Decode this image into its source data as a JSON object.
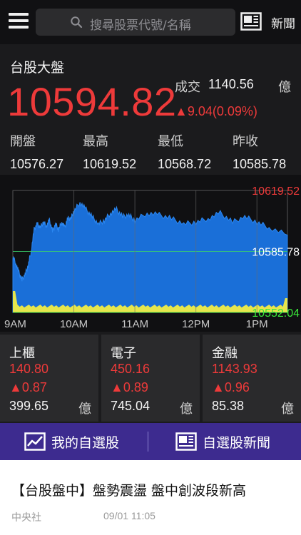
{
  "topbar": {
    "search_placeholder": "搜尋股票代號/名稱",
    "news_label": "新聞"
  },
  "index": {
    "title": "台股大盤",
    "value": "10594.82",
    "volume_label": "成交",
    "volume_value": "1140.56",
    "volume_unit": "億",
    "change": "▲9.04(0.09%)",
    "stats": [
      {
        "label": "開盤",
        "value": "10576.27"
      },
      {
        "label": "最高",
        "value": "10619.52"
      },
      {
        "label": "最低",
        "value": "10568.72"
      },
      {
        "label": "昨收",
        "value": "10585.78"
      }
    ]
  },
  "chart_data": {
    "type": "area",
    "x_ticks": [
      "9AM",
      "10AM",
      "11AM",
      "12PM",
      "1PM"
    ],
    "y_labels": [
      {
        "value": "10619.52",
        "color": "#ee3a3a"
      },
      {
        "value": "10585.78",
        "color": "#ffffff"
      },
      {
        "value": "10552.04",
        "color": "#39e639"
      }
    ],
    "ylim": [
      10552.04,
      10619.52
    ],
    "reference": 10585.78,
    "series": [
      {
        "kind": "price-area",
        "color": "#1a6fd8",
        "x": [
          0,
          0.05,
          0.1,
          0.15,
          0.2,
          0.25,
          0.3,
          0.35,
          0.4,
          0.45,
          0.5,
          0.55,
          0.6,
          0.65,
          0.7,
          0.75,
          0.8,
          0.85,
          0.9,
          0.95,
          1.0,
          1.1,
          1.2,
          1.3,
          1.4,
          1.5,
          1.6,
          1.7,
          1.8,
          1.9,
          2.0,
          2.2,
          2.4,
          2.6,
          2.8,
          3.0,
          3.2,
          3.4,
          3.6,
          3.8,
          4.0,
          4.2,
          4.5
        ],
        "values": [
          10583,
          10579,
          10574,
          10570,
          10573,
          10578,
          10586,
          10598,
          10601,
          10599,
          10602,
          10600,
          10603,
          10597,
          10601,
          10598,
          10602,
          10599,
          10604,
          10604,
          10608,
          10613,
          10609,
          10605,
          10601,
          10603,
          10607,
          10609,
          10605,
          10606,
          10603,
          10607,
          10606,
          10604,
          10601,
          10602,
          10604,
          10607,
          10602,
          10605,
          10602,
          10599,
          10594.82
        ]
      },
      {
        "kind": "volume",
        "color": "#e6e64c"
      }
    ]
  },
  "sectors": [
    {
      "name": "上櫃",
      "price": "140.80",
      "change": "▲0.87",
      "volume": "399.65",
      "unit": "億"
    },
    {
      "name": "電子",
      "price": "450.16",
      "change": "▲0.89",
      "volume": "745.04",
      "unit": "億"
    },
    {
      "name": "金融",
      "price": "1143.93",
      "change": "▲0.96",
      "volume": "85.38",
      "unit": "億"
    }
  ],
  "actions": {
    "watchlist": "我的自選股",
    "watchlist_news": "自選股新聞"
  },
  "news": {
    "headline": "【台股盤中】盤勢震盪 盤中創波段新高",
    "source": "中央社",
    "time": "09/01 11:05"
  }
}
